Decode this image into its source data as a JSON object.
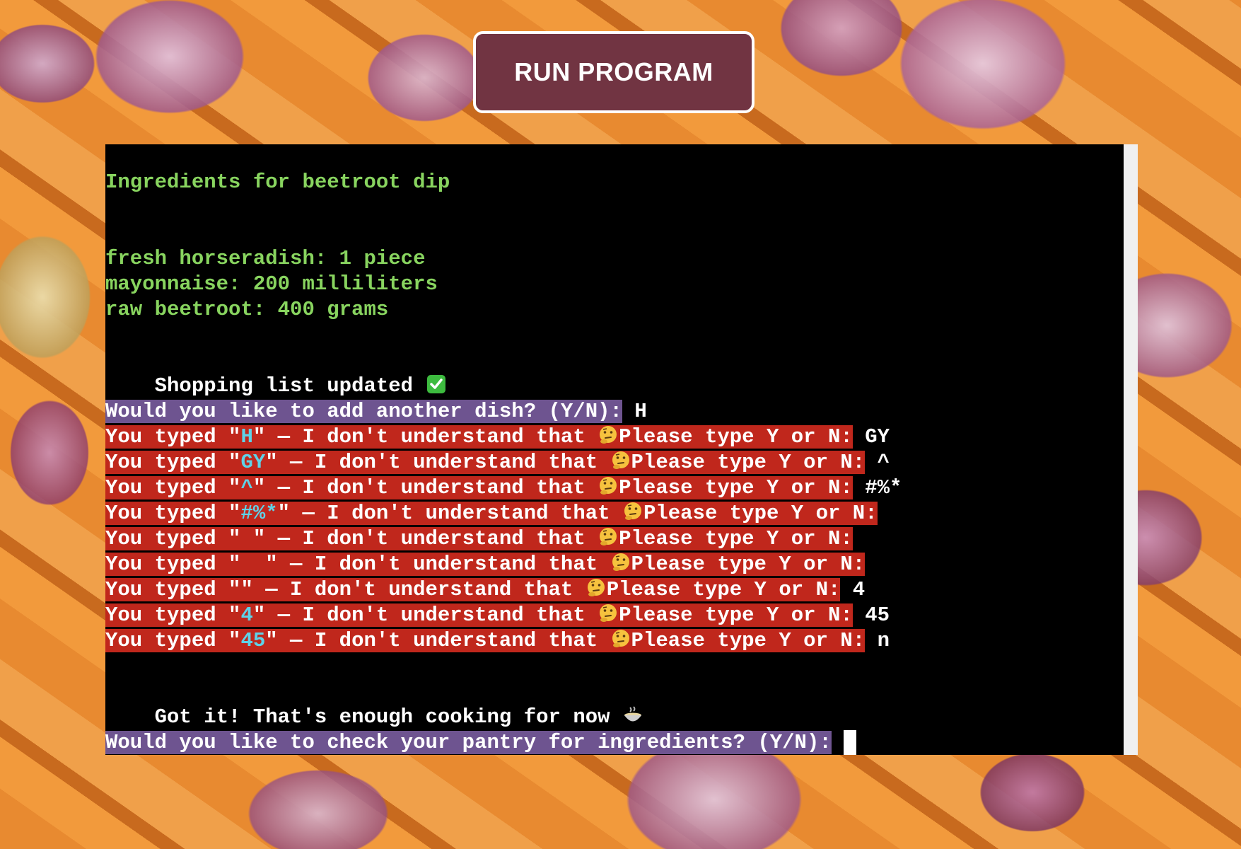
{
  "run_button": {
    "label": "RUN PROGRAM"
  },
  "terminal": {
    "title_line": "Ingredients for beetroot dip",
    "ingredients": [
      "fresh horseradish: 1 piece",
      "mayonnaise: 200 milliliters",
      "raw beetroot: 400 grams"
    ],
    "shopping_updated": "Shopping list updated ",
    "add_dish_prompt": "Would you like to add another dish? (Y/N):",
    "add_dish_answer": "H",
    "error_lines": [
      {
        "prefix": "You typed \"",
        "value": "H",
        "suffix": "\" — I don't understand that ",
        "please": "Please type Y or N:",
        "answer": "GY"
      },
      {
        "prefix": "You typed \"",
        "value": "GY",
        "suffix": "\" — I don't understand that ",
        "please": "Please type Y or N:",
        "answer": "^"
      },
      {
        "prefix": "You typed \"",
        "value": "^",
        "suffix": "\" — I don't understand that ",
        "please": "Please type Y or N:",
        "answer": "#%*"
      },
      {
        "prefix": "You typed \"",
        "value": "#%*",
        "suffix": "\" — I don't understand that ",
        "please": "Please type Y or N:",
        "answer": ""
      },
      {
        "prefix": "You typed \"",
        "value": " ",
        "suffix": "\" — I don't understand that ",
        "please": "Please type Y or N:",
        "answer": ""
      },
      {
        "prefix": "You typed \"",
        "value": "  ",
        "suffix": "\" — I don't understand that ",
        "please": "Please type Y or N:",
        "answer": ""
      },
      {
        "prefix": "You typed \"",
        "value": "",
        "suffix": "\" — I don't understand that ",
        "please": "Please type Y or N:",
        "answer": "4"
      },
      {
        "prefix": "You typed \"",
        "value": "4",
        "suffix": "\" — I don't understand that ",
        "please": "Please type Y or N:",
        "answer": "45"
      },
      {
        "prefix": "You typed \"",
        "value": "45",
        "suffix": "\" — I don't understand that ",
        "please": "Please type Y or N:",
        "answer": "n"
      }
    ],
    "enough_line": "Got it! That's enough cooking for now ",
    "pantry_prompt": "Would you like to check your pantry for ingredients? (Y/N):"
  },
  "icons": {
    "check": "check-mark-icon",
    "thinking": "thinking-face-icon",
    "soup": "soup-bowl-icon"
  },
  "colors": {
    "button_bg": "#713442",
    "terminal_bg": "#000000",
    "green_text": "#88d45f",
    "prompt_highlight": "#6e5490",
    "error_highlight": "#c0271c",
    "typed_value": "#5ed2e8"
  }
}
